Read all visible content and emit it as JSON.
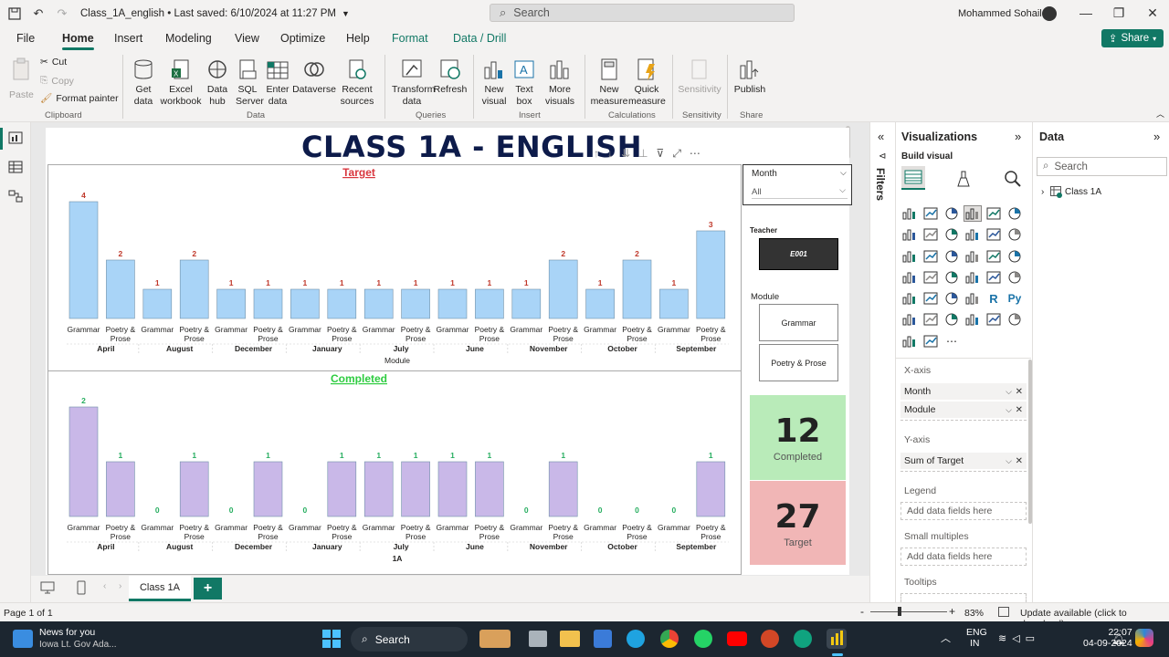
{
  "titlebar": {
    "doc_title": "Class_1A_english • Last saved: 6/10/2024 at 11:27 PM",
    "search_placeholder": "Search",
    "user_name": "Mohammed Sohail"
  },
  "menu": {
    "items": [
      "File",
      "Home",
      "Insert",
      "Modeling",
      "View",
      "Optimize",
      "Help",
      "Format",
      "Data / Drill"
    ],
    "active": "Home",
    "share_label": "Share"
  },
  "ribbon": {
    "clipboard": {
      "paste": "Paste",
      "cut": "Cut",
      "copy": "Copy",
      "format_painter": "Format painter",
      "group": "Clipboard"
    },
    "data": {
      "get_data": "Get data",
      "excel": "Excel workbook",
      "data_hub": "Data hub",
      "sql": "SQL Server",
      "enter": "Enter data",
      "dataverse": "Dataverse",
      "recent": "Recent sources",
      "group": "Data"
    },
    "queries": {
      "transform": "Transform data",
      "refresh": "Refresh",
      "group": "Queries"
    },
    "insert": {
      "new_visual": "New visual",
      "text_box": "Text box",
      "more_visuals": "More visuals",
      "group": "Insert"
    },
    "calculations": {
      "new_measure": "New measure",
      "quick_measure": "Quick measure",
      "group": "Calculations"
    },
    "sensitivity": {
      "label": "Sensitivity",
      "group": "Sensitivity"
    },
    "share": {
      "publish": "Publish",
      "group": "Share"
    }
  },
  "report": {
    "title": "CLASS 1A - ENGLISH",
    "slicer_month": {
      "label": "Month",
      "value": "All"
    },
    "slicer_teacher": {
      "label": "Teacher",
      "value": "E001"
    },
    "slicer_module": {
      "label": "Module",
      "items": [
        "Grammar",
        "Poetry & Prose"
      ]
    },
    "kpi_completed": {
      "value": "12",
      "label": "Completed"
    },
    "kpi_target": {
      "value": "27",
      "label": "Target"
    },
    "page_tab": "Class 1A"
  },
  "chart_data": [
    {
      "type": "bar",
      "title": "Target",
      "xlabel": "Module",
      "categories": [
        "Grammar",
        "Poetry & Prose",
        "Grammar",
        "Poetry & Prose",
        "Grammar",
        "Poetry & Prose",
        "Grammar",
        "Poetry & Prose",
        "Grammar",
        "Poetry & Prose",
        "Grammar",
        "Poetry & Prose",
        "Grammar",
        "Poetry & Prose",
        "Grammar",
        "Poetry & Prose",
        "Grammar",
        "Poetry & Prose"
      ],
      "groups": [
        "April",
        "August",
        "December",
        "January",
        "July",
        "June",
        "November",
        "October",
        "September"
      ],
      "values": [
        4,
        2,
        1,
        2,
        1,
        1,
        1,
        1,
        1,
        1,
        1,
        1,
        1,
        2,
        1,
        2,
        1,
        3
      ],
      "color": "#a9d4f7",
      "label_color": "#c0392b",
      "title_color": "#d9363e"
    },
    {
      "type": "bar",
      "title": "Completed",
      "xlabel": "1A",
      "categories": [
        "Grammar",
        "Poetry & Prose",
        "Grammar",
        "Poetry & Prose",
        "Grammar",
        "Poetry & Prose",
        "Grammar",
        "Poetry & Prose",
        "Grammar",
        "Poetry & Prose",
        "Grammar",
        "Poetry & Prose",
        "Grammar",
        "Poetry & Prose",
        "Grammar",
        "Poetry & Prose",
        "Grammar",
        "Poetry & Prose"
      ],
      "groups": [
        "April",
        "August",
        "December",
        "January",
        "July",
        "June",
        "November",
        "October",
        "September"
      ],
      "values": [
        2,
        1,
        0,
        1,
        0,
        1,
        0,
        1,
        1,
        1,
        1,
        1,
        0,
        1,
        0,
        0,
        0,
        1
      ],
      "color": "#c9b8e8",
      "label_color": "#27ae60",
      "title_color": "#2ecc40"
    }
  ],
  "panes": {
    "filters_label": "Filters",
    "viz_title": "Visualizations",
    "build_visual": "Build visual",
    "xaxis_label": "X-axis",
    "xaxis_fields": [
      "Month",
      "Module"
    ],
    "yaxis_label": "Y-axis",
    "yaxis_fields": [
      "Sum of Target"
    ],
    "legend_label": "Legend",
    "legend_placeholder": "Add data fields here",
    "small_multiples_label": "Small multiples",
    "small_multiples_placeholder": "Add data fields here",
    "tooltips_label": "Tooltips",
    "data_title": "Data",
    "data_search": "Search",
    "data_table": "Class 1A"
  },
  "status": {
    "page": "Page 1 of 1",
    "zoom": "83%",
    "update": "Update available (click to download)"
  },
  "taskbar": {
    "news_title": "News for you",
    "news_sub": "Iowa Lt. Gov Ada...",
    "search": "Search",
    "lang1": "ENG",
    "lang2": "IN",
    "time": "22:07",
    "date": "04-09-2024"
  }
}
